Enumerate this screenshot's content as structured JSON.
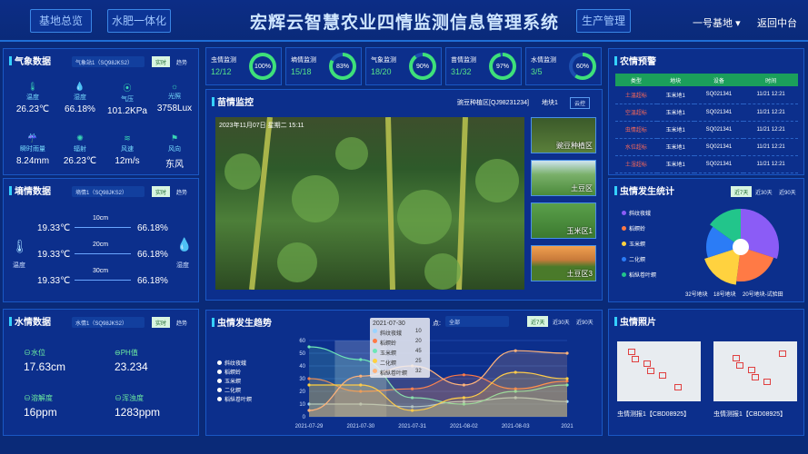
{
  "header": {
    "nav_left_1": "基地总览",
    "nav_left_2": "水肥一体化",
    "title": "宏辉云智慧农业四情监测信息管理系统",
    "nav_right": "生产管理",
    "base": "一号基地",
    "back": "返回中台"
  },
  "weather": {
    "title": "气象数据",
    "station": "气象站1（SQ98JKS2）",
    "tab_rt": "实时",
    "tab_hist": "趋势",
    "items": [
      {
        "icon": "thermometer-icon",
        "label": "温度",
        "value": "26.23℃"
      },
      {
        "icon": "humidity-icon",
        "label": "湿度",
        "value": "66.18%"
      },
      {
        "icon": "pressure-icon",
        "label": "气压",
        "value": "101.2KPa"
      },
      {
        "icon": "light-icon",
        "label": "光照",
        "value": "3758Lux"
      },
      {
        "icon": "rain-icon",
        "label": "瞬时雨量",
        "value": "8.24mm"
      },
      {
        "icon": "radiation-icon",
        "label": "辐射",
        "value": "26.23℃"
      },
      {
        "icon": "wind-speed-icon",
        "label": "风速",
        "value": "12m/s"
      },
      {
        "icon": "wind-direction-icon",
        "label": "风向",
        "value": "东风"
      }
    ]
  },
  "soil": {
    "title": "墒情数据",
    "station": "墒情1（SQ98JKS2）",
    "tab_rt": "实时",
    "tab_hist": "趋势",
    "left_label": "温度",
    "right_label": "湿度",
    "rows": [
      {
        "depth": "10cm",
        "temp": "19.33℃",
        "hum": "66.18%"
      },
      {
        "depth": "20cm",
        "temp": "19.33℃",
        "hum": "66.18%"
      },
      {
        "depth": "30cm",
        "temp": "19.33℃",
        "hum": "66.18%"
      }
    ]
  },
  "water": {
    "title": "水情数据",
    "station": "水情1（SQ98JKS2）",
    "tab_rt": "实时",
    "tab_hist": "趋势",
    "items": [
      {
        "label": "水位",
        "value": "17.63cm"
      },
      {
        "label": "PH值",
        "value": "23.234"
      },
      {
        "label": "溶解度",
        "value": "16ppm"
      },
      {
        "label": "浑浊度",
        "value": "1283ppm"
      }
    ]
  },
  "stats": [
    {
      "name": "虫情监测",
      "value": "12/12",
      "percent": 100
    },
    {
      "name": "墒情监测",
      "value": "15/18",
      "percent": 83
    },
    {
      "name": "气象监测",
      "value": "18/20",
      "percent": 90
    },
    {
      "name": "苗情监测",
      "value": "31/32",
      "percent": 97
    },
    {
      "name": "水情监测",
      "value": "3/5",
      "percent": 60
    }
  ],
  "seedling": {
    "title": "苗情监控",
    "area": "豌豆种植区[QJ98231234]",
    "site": "地块1",
    "cloud": "云控",
    "timestamp": "2023年11月07日 星期二 15:11",
    "thumbs": [
      "豌豆种植区",
      "土豆区",
      "玉米区1",
      "土豆区3"
    ]
  },
  "warnings": {
    "title": "农情预警",
    "headers": [
      "类型",
      "地块",
      "设备",
      "时间"
    ],
    "rows": [
      [
        "土温超标",
        "玉米地1",
        "SQ021341",
        "11/21 12:21"
      ],
      [
        "空温超标",
        "玉米地1",
        "SQ021341",
        "11/21 12:21"
      ],
      [
        "虫情超标",
        "玉米地1",
        "SQ021341",
        "11/21 12:21"
      ],
      [
        "水位超标",
        "玉米地1",
        "SQ021341",
        "11/21 12:21"
      ],
      [
        "土湿超标",
        "玉米地1",
        "SQ021341",
        "11/21 12:21"
      ]
    ]
  },
  "pest_stats": {
    "title": "虫情发生统计",
    "tab_7": "近7天",
    "tab_30": "近30天",
    "tab_90": "近90天",
    "legend": [
      "斜纹夜蛾",
      "稻螟蛉",
      "玉米螟",
      "二化螟",
      "稻纵卷叶螟"
    ],
    "colors": [
      "#8b5cf6",
      "#ff7a45",
      "#ffd23f",
      "#2b7cf6",
      "#22c58b"
    ],
    "values": [
      30,
      22,
      18,
      15,
      15
    ],
    "plots": [
      "32号地块",
      "18号地块",
      "20号地块-试验田"
    ]
  },
  "pest_trend": {
    "title": "虫情发生趋势",
    "point_label": "点:",
    "point_value": "全部",
    "tab_7": "近7天",
    "tab_30": "近30天",
    "tab_90": "近90天",
    "tooltip": {
      "date": "2021-07-30",
      "rows": [
        [
          "斜纹夜蛾",
          "10"
        ],
        [
          "稻螟蛉",
          "20"
        ],
        [
          "玉米螟",
          "45"
        ],
        [
          "二化螟",
          "25"
        ],
        [
          "稻纵卷叶螟",
          "32"
        ]
      ]
    }
  },
  "chart_data": {
    "type": "line",
    "x": [
      "2021-07-29",
      "2021-07-30",
      "2021-07-31",
      "2021-08-02",
      "2021-08-03",
      "2021"
    ],
    "ylim": [
      0,
      60
    ],
    "yticks": [
      0,
      10,
      20,
      30,
      40,
      50,
      60
    ],
    "series": [
      {
        "name": "斜纹夜蛾",
        "color": "#9ad4ff",
        "values": [
          10,
          10,
          8,
          12,
          15,
          12
        ]
      },
      {
        "name": "稻螟蛉",
        "color": "#ff7a45",
        "values": [
          30,
          20,
          22,
          33,
          22,
          28
        ]
      },
      {
        "name": "玉米螟",
        "color": "#6ee7b7",
        "values": [
          55,
          45,
          15,
          10,
          20,
          25
        ]
      },
      {
        "name": "二化螟",
        "color": "#ffd23f",
        "values": [
          25,
          25,
          5,
          15,
          35,
          30
        ]
      },
      {
        "name": "稻纵卷叶螟",
        "color": "#ffb37a",
        "values": [
          5,
          32,
          40,
          25,
          52,
          50
        ]
      }
    ]
  },
  "pest_photos": {
    "title": "虫情照片",
    "captions": [
      "虫情测报1【CBD08925】",
      "虫情测报1【CBD08925】"
    ]
  }
}
